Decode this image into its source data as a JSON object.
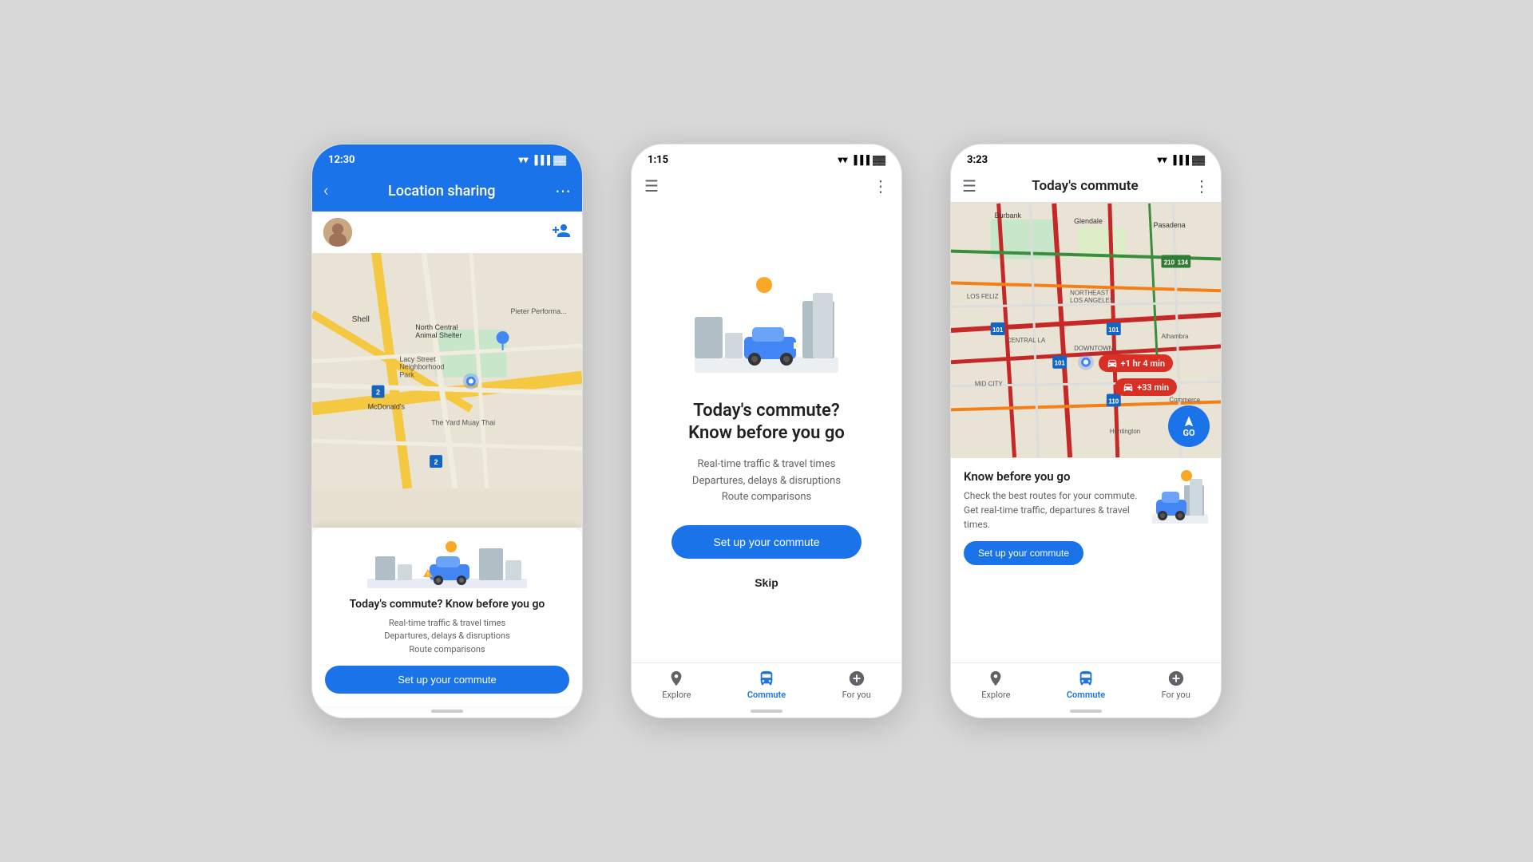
{
  "background_color": "#d8d8d8",
  "phones": {
    "phone1": {
      "status_time": "12:30",
      "header_title": "Location sharing",
      "back_label": "‹",
      "more_label": "⋯",
      "card": {
        "title": "Today's commute? Know before you go",
        "desc_line1": "Real-time traffic & travel times",
        "desc_line2": "Departures, delays & disruptions",
        "desc_line3": "Route comparisons",
        "button_label": "Set up your commute"
      }
    },
    "phone2": {
      "status_time": "1:15",
      "big_title_line1": "Today's commute?",
      "big_title_line2": "Know before you go",
      "desc_line1": "Real-time traffic & travel times",
      "desc_line2": "Departures, delays & disruptions",
      "desc_line3": "Route comparisons",
      "button_label": "Set up your commute",
      "skip_label": "Skip",
      "nav": {
        "explore_label": "Explore",
        "commute_label": "Commute",
        "foryou_label": "For you"
      }
    },
    "phone3": {
      "status_time": "3:23",
      "header_title": "Today's commute",
      "traffic_badge1": "+1 hr 4 min",
      "traffic_badge2": "+33 min",
      "go_label": "GO",
      "card": {
        "title": "Know before you go",
        "desc": "Check the best routes for your commute. Get real-time traffic, departures & travel times.",
        "button_label": "Set up your commute"
      },
      "nav": {
        "explore_label": "Explore",
        "commute_label": "Commute",
        "foryou_label": "For you"
      },
      "map_labels": {
        "burbank": "Burbank",
        "glendale": "Glendale",
        "pasadena": "Pasadena",
        "los_feliz": "LOS FELIZ",
        "central_la": "CENTRAL LA",
        "mid_city": "MID CITY",
        "huntington": "Huntington",
        "alhambra": "Alhambra",
        "commerce": "Commerce",
        "downtown": "DOWNTOWN"
      }
    }
  },
  "icons": {
    "back": "‹",
    "more": "⋯",
    "hamburger": "≡",
    "dots": "⋮",
    "location_pin": "📍",
    "home": "🏠",
    "person_add": "👤+",
    "car": "🚗",
    "commute": "🚌",
    "foryou": "➕"
  }
}
